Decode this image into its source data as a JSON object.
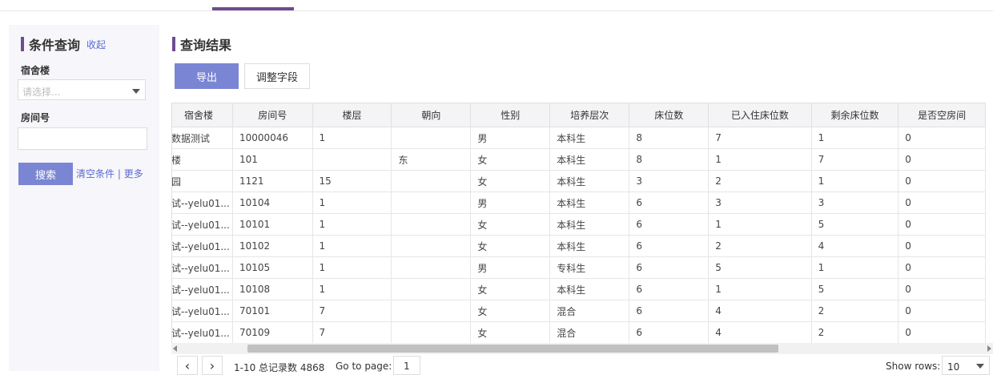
{
  "sidebar": {
    "title": "条件查询",
    "collapse": "收起",
    "dorm_label": "宿舍楼",
    "dorm_placeholder": "请选择...",
    "room_label": "房间号",
    "room_value": "",
    "search_button": "搜索",
    "clear_link": "清空条件",
    "separator": "|",
    "more_link": "更多"
  },
  "main": {
    "title": "查询结果",
    "export_button": "导出",
    "adjust_button": "调整字段"
  },
  "table": {
    "headers": [
      "宿舍楼",
      "房间号",
      "楼层",
      "朝向",
      "性别",
      "培养层次",
      "床位数",
      "已入住床位数",
      "剩余床位数",
      "是否空房间"
    ],
    "rows": [
      [
        "数据测试",
        "10000046",
        "1",
        "",
        "男",
        "本科生",
        "8",
        "7",
        "1",
        "0"
      ],
      [
        "楼",
        "101",
        "",
        "东",
        "女",
        "本科生",
        "8",
        "1",
        "7",
        "0"
      ],
      [
        "园",
        "1121",
        "15",
        "",
        "女",
        "本科生",
        "3",
        "2",
        "1",
        "0"
      ],
      [
        "试--yelu01...",
        "10104",
        "1",
        "",
        "男",
        "本科生",
        "6",
        "3",
        "3",
        "0"
      ],
      [
        "试--yelu01...",
        "10101",
        "1",
        "",
        "女",
        "本科生",
        "6",
        "1",
        "5",
        "0"
      ],
      [
        "试--yelu01...",
        "10102",
        "1",
        "",
        "女",
        "本科生",
        "6",
        "2",
        "4",
        "0"
      ],
      [
        "试--yelu01...",
        "10105",
        "1",
        "",
        "男",
        "专科生",
        "6",
        "5",
        "1",
        "0"
      ],
      [
        "试--yelu01...",
        "10108",
        "1",
        "",
        "女",
        "本科生",
        "6",
        "1",
        "5",
        "0"
      ],
      [
        "试--yelu01...",
        "70101",
        "7",
        "",
        "女",
        "混合",
        "6",
        "4",
        "2",
        "0"
      ],
      [
        "试--yelu01...",
        "70109",
        "7",
        "",
        "女",
        "混合",
        "6",
        "4",
        "2",
        "0"
      ]
    ]
  },
  "pager": {
    "prev": "‹",
    "next": "›",
    "info": "1-10 总记录数 4868",
    "goto_label": "Go to page:",
    "page_value": "1",
    "rows_label": "Show rows:",
    "rows_value": "10"
  },
  "colors": {
    "accent": "#6f4b92",
    "button": "#7a86d4",
    "link": "#5a6bd1"
  }
}
